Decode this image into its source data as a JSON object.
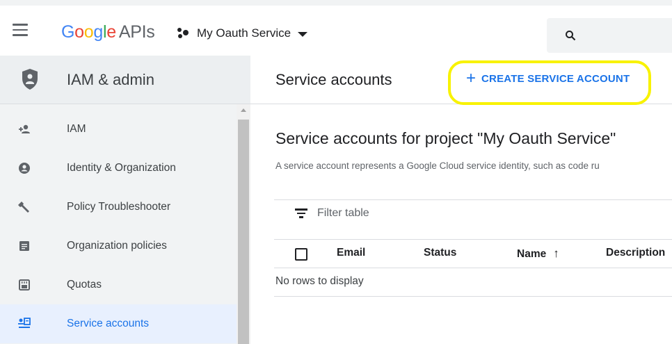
{
  "header": {
    "logo_parts": [
      "G",
      "o",
      "o",
      "g",
      "l",
      "e"
    ],
    "logo_suffix": "APIs",
    "project_name": "My Oauth Service",
    "search_icon": "search-icon",
    "colors": {
      "blue": "#4285f4",
      "red": "#ea4335",
      "yellow": "#fbbc05",
      "green": "#34a853"
    }
  },
  "sidebar": {
    "title": "IAM & admin",
    "title_icon": "shield-icon",
    "items": [
      {
        "label": "IAM",
        "icon": "person-add-icon",
        "active": false
      },
      {
        "label": "Identity & Organization",
        "icon": "account-circle-icon",
        "active": false
      },
      {
        "label": "Policy Troubleshooter",
        "icon": "wrench-icon",
        "active": false
      },
      {
        "label": "Organization policies",
        "icon": "document-icon",
        "active": false
      },
      {
        "label": "Quotas",
        "icon": "quota-icon",
        "active": false
      },
      {
        "label": "Service accounts",
        "icon": "service-account-icon",
        "active": true
      }
    ]
  },
  "main": {
    "title": "Service accounts",
    "create_button": {
      "icon": "+",
      "label": "CREATE SERVICE ACCOUNT"
    },
    "section_title": "Service accounts for project \"My Oauth Service\"",
    "section_description": "A service account represents a Google Cloud service identity, such as code ru",
    "table": {
      "filter_placeholder": "Filter table",
      "columns": [
        "Email",
        "Status",
        "Name",
        "Description"
      ],
      "sort_indicator": "↑",
      "empty_message": "No rows to display"
    },
    "accent_color": "#1a73e8",
    "highlight_color": "#f8f200"
  }
}
